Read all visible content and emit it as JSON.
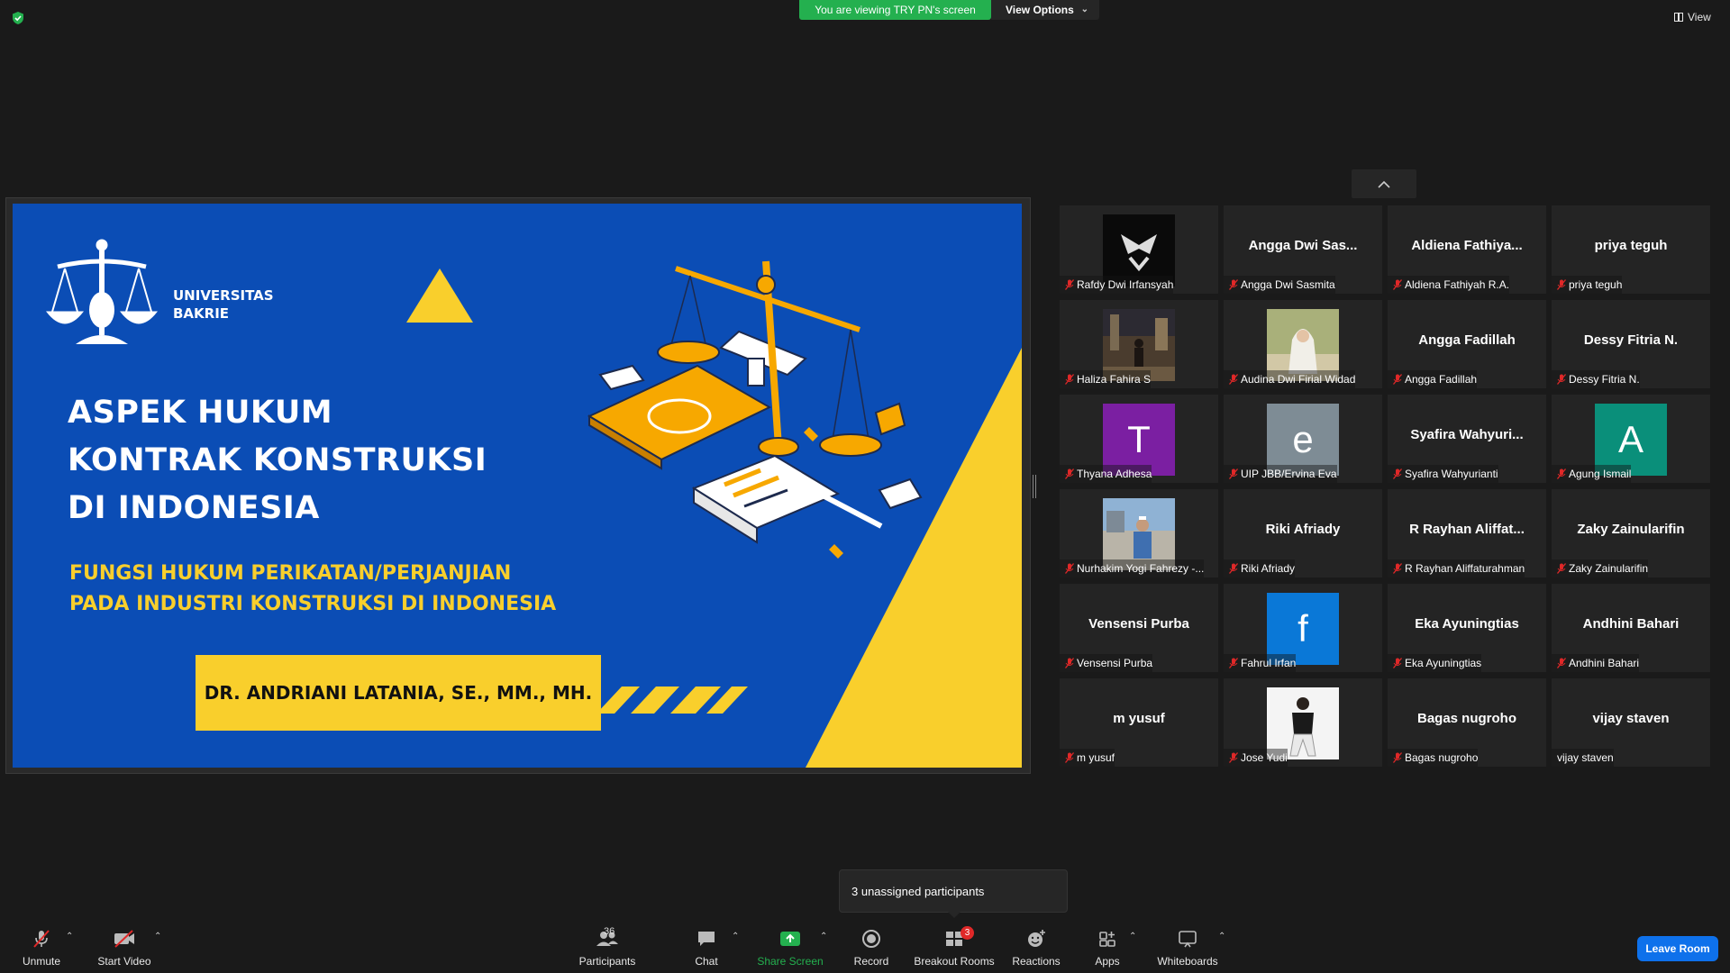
{
  "top": {
    "viewing_banner": "You are viewing TRY PN's screen",
    "view_options": "View Options",
    "view": "View"
  },
  "slide": {
    "university": [
      "UNIVERSITAS",
      "BAKRIE"
    ],
    "title": [
      "ASPEK HUKUM",
      "KONTRAK KONSTRUKSI",
      "DI INDONESIA"
    ],
    "subtitle": [
      "FUNGSI HUKUM PERIKATAN/PERJANJIAN",
      "PADA INDUSTRI KONSTRUKSI DI INDONESIA"
    ],
    "author": "DR. ANDRIANI LATANIA, SE., MM., MH.",
    "colors": {
      "background": "#0b4db5",
      "accent": "#f9cf2c"
    }
  },
  "gallery": {
    "tiles": [
      {
        "type": "photo",
        "photo": "logo-icon",
        "label": "Rafdy Dwi Irfansyah",
        "muted": true
      },
      {
        "type": "name",
        "big_name": "Angga Dwi Sas...",
        "label": "Angga Dwi Sasmita",
        "muted": true
      },
      {
        "type": "name",
        "big_name": "Aldiena Fathiya...",
        "label": "Aldiena Fathiyah R.A.",
        "muted": true
      },
      {
        "type": "name",
        "big_name": "priya teguh",
        "label": "priya teguh",
        "muted": true
      },
      {
        "type": "photo",
        "photo": "night-photo",
        "label": "Haliza Fahira S",
        "muted": true
      },
      {
        "type": "photo",
        "photo": "hijab-photo",
        "label": "Audina Dwi Firial Widad",
        "muted": true
      },
      {
        "type": "name",
        "big_name": "Angga Fadillah",
        "label": "Angga Fadillah",
        "muted": true
      },
      {
        "type": "name",
        "big_name": "Dessy Fitria N.",
        "label": "Dessy Fitria N.",
        "muted": true
      },
      {
        "type": "avatar",
        "letter": "T",
        "color": "#7b1fa2",
        "label": "Thyana Adhesa",
        "muted": true
      },
      {
        "type": "avatar",
        "letter": "e",
        "color": "#7e8c95",
        "label": "UIP JBB/Ervina Eva",
        "muted": true
      },
      {
        "type": "name",
        "big_name": "Syafira  Wahyuri...",
        "label": "Syafira Wahyurianti",
        "muted": true
      },
      {
        "type": "avatar",
        "letter": "A",
        "color": "#0a8f7a",
        "label": "Agung Ismail",
        "muted": true
      },
      {
        "type": "photo",
        "photo": "site-photo",
        "label": "Nurhakim Yogi Fahrezy -...",
        "muted": true
      },
      {
        "type": "name",
        "big_name": "Riki Afriady",
        "label": "Riki Afriady",
        "muted": true
      },
      {
        "type": "name",
        "big_name": "R Rayhan Aliffat...",
        "label": "R Rayhan Aliffaturahman",
        "muted": true
      },
      {
        "type": "name",
        "big_name": "Zaky Zainularifin",
        "label": "Zaky Zainularifin",
        "muted": true
      },
      {
        "type": "name",
        "big_name": "Vensensi Purba",
        "label": "Vensensi Purba",
        "muted": true
      },
      {
        "type": "avatar",
        "letter": "f",
        "color": "#0a78d7",
        "label": "Fahrul Irfan",
        "muted": true
      },
      {
        "type": "name",
        "big_name": "Eka Ayuningtias",
        "label": "Eka Ayuningtias",
        "muted": true
      },
      {
        "type": "name",
        "big_name": "Andhini Bahari",
        "label": "Andhini Bahari",
        "muted": true
      },
      {
        "type": "name",
        "big_name": "m yusuf",
        "label": "m yusuf",
        "muted": true
      },
      {
        "type": "photo",
        "photo": "portrait-photo",
        "label": "Jose Yudi",
        "muted": true
      },
      {
        "type": "name",
        "big_name": "Bagas nugroho",
        "label": "Bagas nugroho",
        "muted": true
      },
      {
        "type": "name",
        "big_name": "vijay staven",
        "label": "vijay staven",
        "muted": false
      }
    ]
  },
  "popup": {
    "unassigned": "3 unassigned participants"
  },
  "toolbar": {
    "unmute": "Unmute",
    "start_video": "Start Video",
    "participants": "Participants",
    "participants_count": "36",
    "chat": "Chat",
    "share_screen": "Share Screen",
    "record": "Record",
    "breakout_rooms": "Breakout Rooms",
    "breakout_badge": "3",
    "reactions": "Reactions",
    "apps": "Apps",
    "whiteboards": "Whiteboards",
    "leave_room": "Leave Room",
    "share_color": "#24b04f"
  }
}
